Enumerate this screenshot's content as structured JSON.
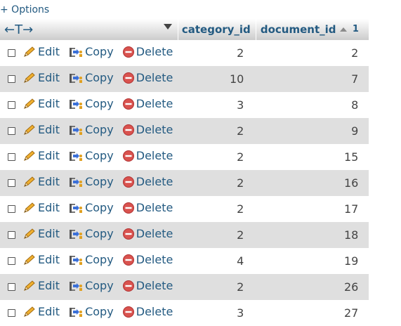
{
  "options_label": "+ Options",
  "header": {
    "arrows": "←T→",
    "columns": [
      "category_id",
      "document_id"
    ],
    "sort_index": "1"
  },
  "actions": {
    "edit": "Edit",
    "copy": "Copy",
    "delete": "Delete"
  },
  "rows": [
    {
      "category_id": "2",
      "document_id": "2"
    },
    {
      "category_id": "10",
      "document_id": "7"
    },
    {
      "category_id": "3",
      "document_id": "8"
    },
    {
      "category_id": "2",
      "document_id": "9"
    },
    {
      "category_id": "2",
      "document_id": "15"
    },
    {
      "category_id": "2",
      "document_id": "16"
    },
    {
      "category_id": "2",
      "document_id": "17"
    },
    {
      "category_id": "2",
      "document_id": "18"
    },
    {
      "category_id": "4",
      "document_id": "19"
    },
    {
      "category_id": "2",
      "document_id": "26"
    },
    {
      "category_id": "3",
      "document_id": "27"
    }
  ],
  "colors": {
    "link": "#235a81",
    "row_alt": "#dfdfdf",
    "delete_icon": "#d9534f"
  }
}
